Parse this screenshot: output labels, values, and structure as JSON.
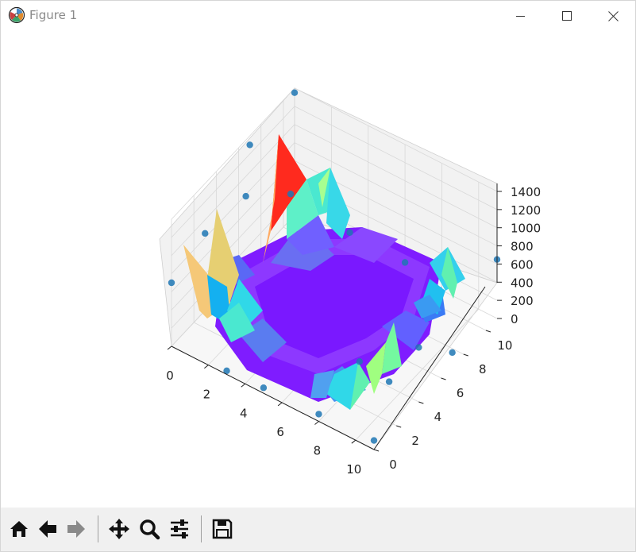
{
  "window": {
    "title": "Figure 1"
  },
  "toolbar": {
    "buttons": [
      {
        "name": "home-button",
        "icon": "home-icon"
      },
      {
        "name": "back-button",
        "icon": "arrow-left-icon"
      },
      {
        "name": "forward-button",
        "icon": "arrow-right-icon"
      },
      {
        "name": "pan-button",
        "icon": "move-icon"
      },
      {
        "name": "zoom-button",
        "icon": "magnifier-icon"
      },
      {
        "name": "configure-subplots-button",
        "icon": "sliders-icon"
      },
      {
        "name": "save-button",
        "icon": "floppy-disk-icon"
      }
    ]
  },
  "chart_data": {
    "type": "surface3d",
    "title": "",
    "xlabel": "",
    "ylabel": "",
    "zlabel": "",
    "x_ticks": [
      "0",
      "2",
      "4",
      "6",
      "8",
      "10"
    ],
    "y_ticks": [
      "0",
      "2",
      "4",
      "6",
      "8",
      "10"
    ],
    "z_ticks": [
      "0",
      "200",
      "400",
      "600",
      "800",
      "1000",
      "1200",
      "1400"
    ],
    "xlim": [
      0,
      11
    ],
    "ylim": [
      0,
      11
    ],
    "zlim": [
      0,
      1400
    ],
    "grid": true,
    "colormap": "rainbow",
    "surface_color_low": "#7f00ff",
    "surface_color_high": "#ff0000",
    "marker_color": "#1f77b4",
    "series": [
      {
        "type": "scatter3d",
        "points": [
          {
            "x": 0,
            "y": 11,
            "z": 1350
          },
          {
            "x": 0,
            "y": 7,
            "z": 1300
          },
          {
            "x": 0,
            "y": 3,
            "z": 850
          },
          {
            "x": 0,
            "y": 0,
            "z": 700
          },
          {
            "x": 1,
            "y": 5,
            "z": 1100
          },
          {
            "x": 1,
            "y": 9,
            "z": 600
          },
          {
            "x": 11,
            "y": 11,
            "z": 650
          },
          {
            "x": 11,
            "y": 7,
            "z": 150
          },
          {
            "x": 11,
            "y": 4,
            "z": 600
          },
          {
            "x": 9,
            "y": 2,
            "z": 500
          },
          {
            "x": 10,
            "y": 3,
            "z": 250
          },
          {
            "x": 11,
            "y": 0,
            "z": 100
          },
          {
            "x": 8,
            "y": 0,
            "z": 80
          },
          {
            "x": 5,
            "y": 0,
            "z": 60
          },
          {
            "x": 3,
            "y": 0,
            "z": 40
          },
          {
            "x": 6,
            "y": 11,
            "z": 100
          },
          {
            "x": 3,
            "y": 11,
            "z": 120
          }
        ]
      }
    ]
  }
}
